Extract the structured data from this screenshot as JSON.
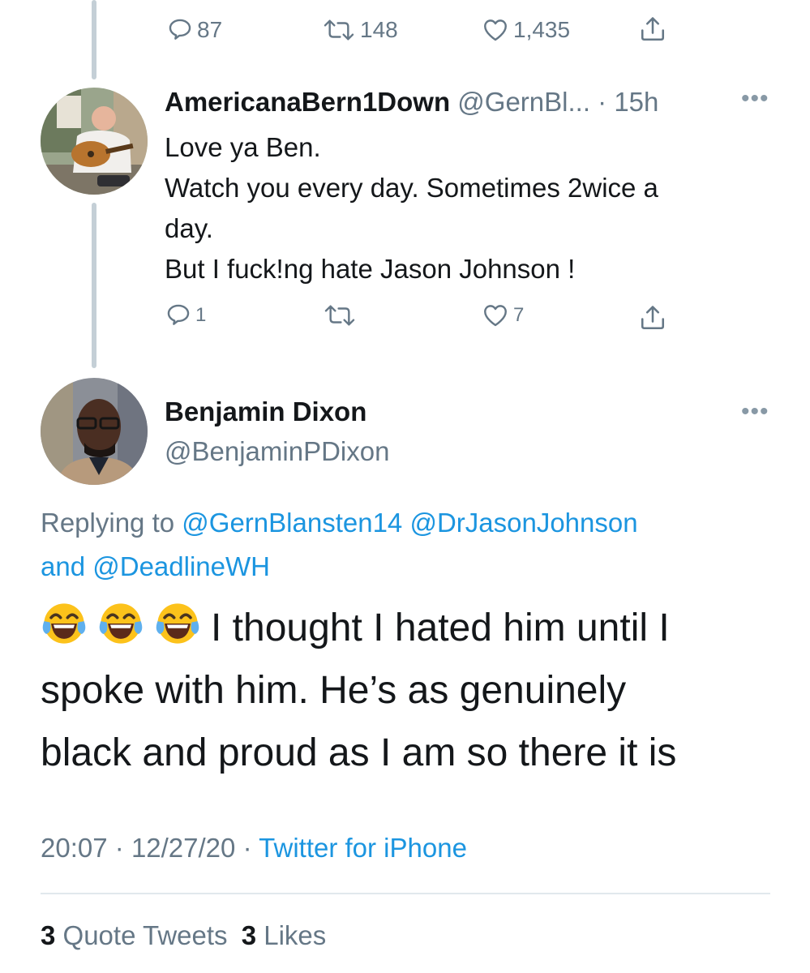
{
  "first_tweet_actions": {
    "replies": "87",
    "retweets": "148",
    "likes": "1,435"
  },
  "reply_tweet": {
    "display_name": "AmericanaBern1Down",
    "handle_truncated": "@GernBl...",
    "time": "· 15h",
    "lines": [
      "Love ya Ben.",
      "Watch you every day. Sometimes 2wice a",
      "day.",
      "But I fuck!ng hate Jason Johnson !"
    ],
    "actions": {
      "replies": "1",
      "retweets": "",
      "likes": "7"
    }
  },
  "main_tweet": {
    "display_name": "Benjamin Dixon",
    "handle": "@BenjaminPDixon",
    "replying_prefix": "Replying to",
    "replying_to": [
      "@GernBlansten14",
      "@DrJasonJohnson"
    ],
    "replying_and": "and",
    "replying_to_last": "@DeadlineWH",
    "emoji": "face-with-tears-of-joy",
    "emoji_count": 3,
    "text_line1": "I thought I hated him until I",
    "text_line2": "spoke with him. He’s as genuinely",
    "text_line3": "black and proud as I am so there it is",
    "time": "20:07",
    "separator": "·",
    "date": "12/27/20",
    "source": "Twitter for iPhone"
  },
  "stats": {
    "quote_count": "3",
    "quote_label": "Quote Tweets",
    "likes_count": "3",
    "likes_label": "Likes"
  },
  "colors": {
    "link": "#1b95e0",
    "secondary_text": "#657786",
    "thread_line": "#c4cfd6",
    "divider": "#e1e8ed"
  }
}
